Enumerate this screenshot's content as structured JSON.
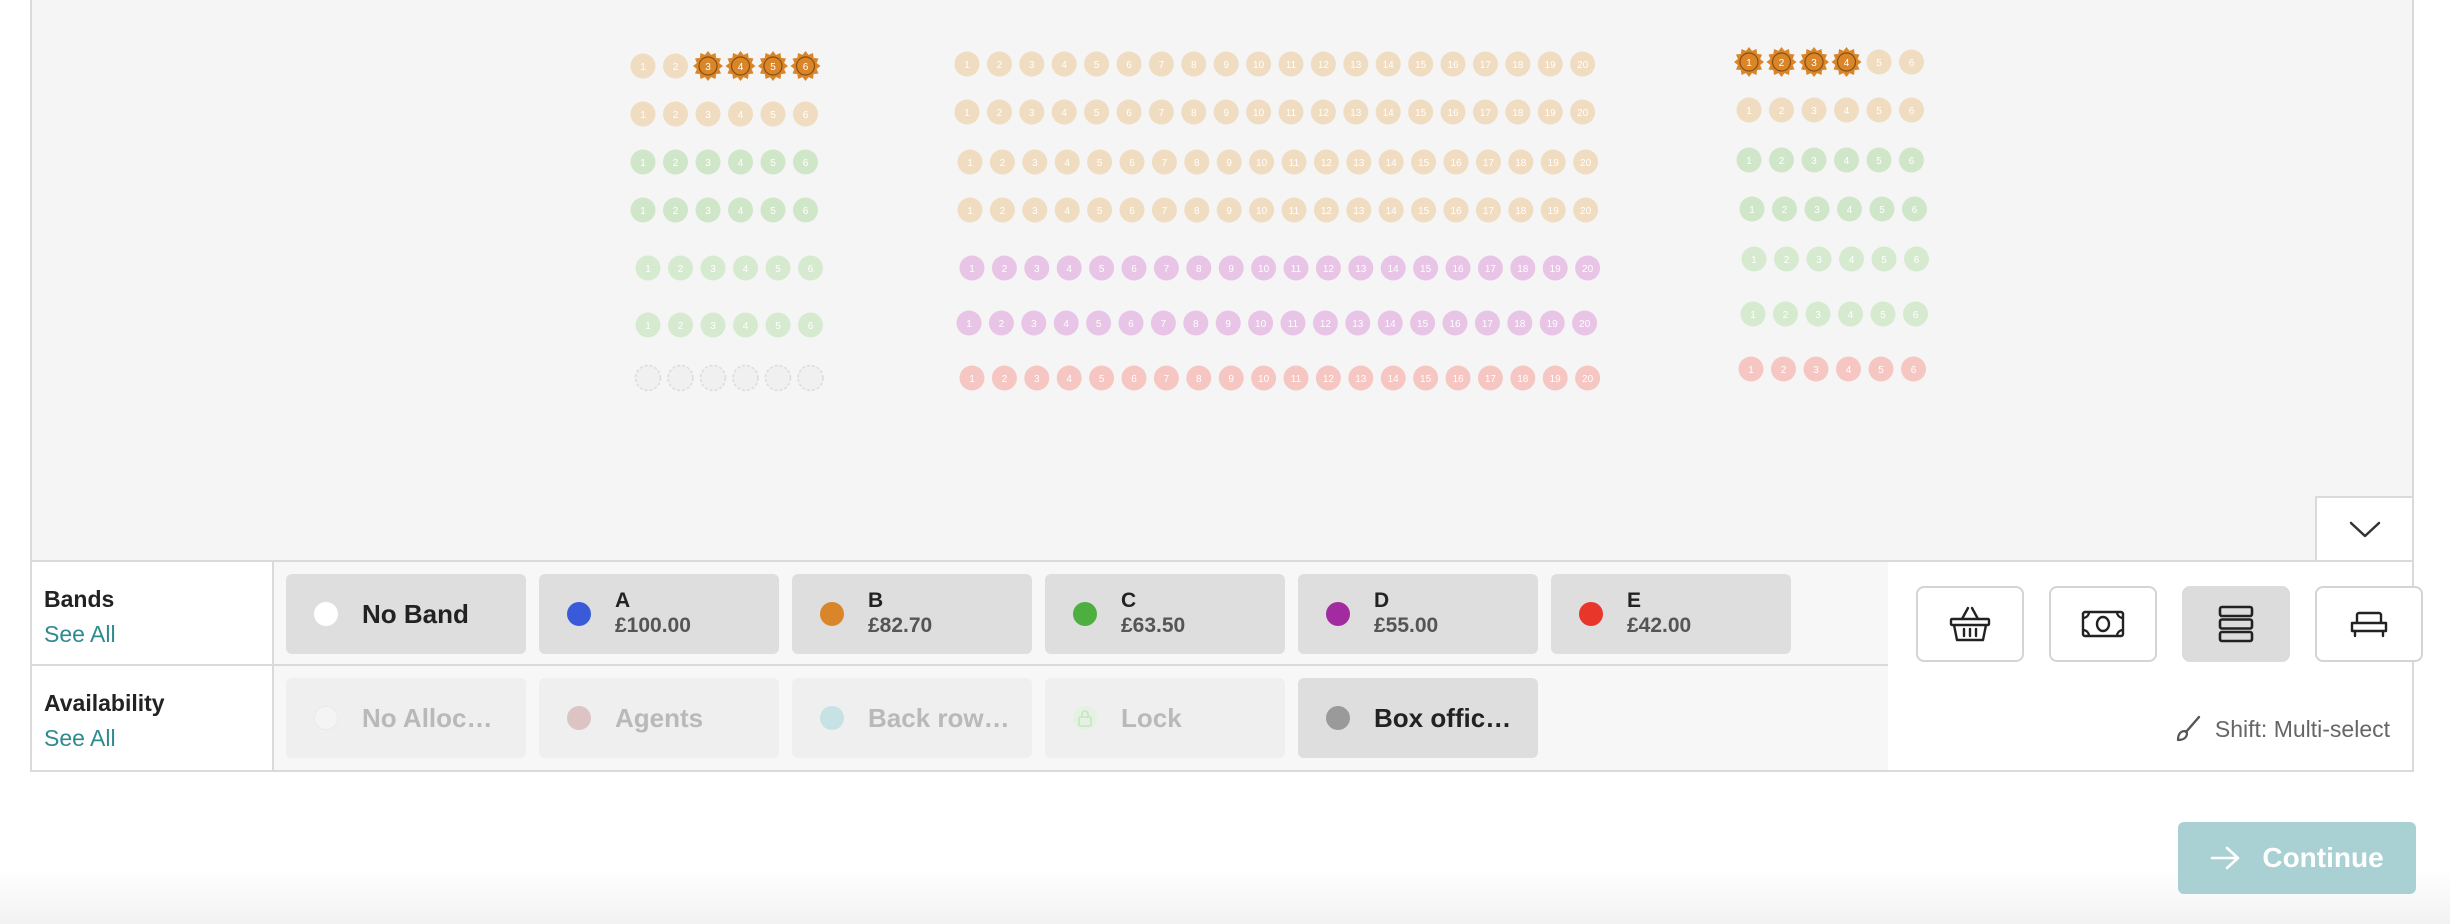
{
  "colors": {
    "no_band": "#ffffff",
    "band_a": "#3a5bd9",
    "band_b": "#d9862b",
    "band_c": "#4caf3f",
    "band_d": "#a22ba0",
    "band_e": "#e8362b",
    "accent_link": "#2f8a8f",
    "continue_bg": "#a9d1d3"
  },
  "seat_map": {
    "left_block": {
      "rows": [
        {
          "seats": [
            "1",
            "2",
            "3",
            "4",
            "5",
            "6"
          ],
          "color": "#f0dcc0",
          "selected": [
            "3",
            "4",
            "5",
            "6"
          ]
        },
        {
          "seats": [
            "1",
            "2",
            "3",
            "4",
            "5",
            "6"
          ],
          "color": "#f0dcc0"
        },
        {
          "seats": [
            "1",
            "2",
            "3",
            "4",
            "5",
            "6"
          ],
          "color": "#cfe6c8"
        },
        {
          "seats": [
            "1",
            "2",
            "3",
            "4",
            "5",
            "6"
          ],
          "color": "#cfe6c8"
        },
        {
          "seats": [
            "1",
            "2",
            "3",
            "4",
            "5",
            "6"
          ],
          "color": "#d6ead0"
        },
        {
          "seats": [
            "1",
            "2",
            "3",
            "4",
            "5",
            "6"
          ],
          "color": "#d6ead0"
        },
        {
          "seats": [
            "",
            "",
            "",
            "",
            "",
            ""
          ],
          "color": "#f0f0f0",
          "dashed": true
        }
      ]
    },
    "center_block": {
      "rows": [
        {
          "seats": [
            "1",
            "2",
            "3",
            "4",
            "5",
            "6",
            "7",
            "8",
            "9",
            "10",
            "11",
            "12",
            "13",
            "14",
            "15",
            "16",
            "17",
            "18",
            "19",
            "20"
          ],
          "color": "#f0dcc0"
        },
        {
          "seats": [
            "1",
            "2",
            "3",
            "4",
            "5",
            "6",
            "7",
            "8",
            "9",
            "10",
            "11",
            "12",
            "13",
            "14",
            "15",
            "16",
            "17",
            "18",
            "19",
            "20"
          ],
          "color": "#f0dcc0"
        },
        {
          "seats": [
            "1",
            "2",
            "3",
            "4",
            "5",
            "6",
            "7",
            "8",
            "9",
            "10",
            "11",
            "12",
            "13",
            "14",
            "15",
            "16",
            "17",
            "18",
            "19",
            "20"
          ],
          "color": "#f0dcc0"
        },
        {
          "seats": [
            "1",
            "2",
            "3",
            "4",
            "5",
            "6",
            "7",
            "8",
            "9",
            "10",
            "11",
            "12",
            "13",
            "14",
            "15",
            "16",
            "17",
            "18",
            "19",
            "20"
          ],
          "color": "#f0dcc0"
        },
        {
          "seats": [
            "1",
            "2",
            "3",
            "4",
            "5",
            "6",
            "7",
            "8",
            "9",
            "10",
            "11",
            "12",
            "13",
            "14",
            "15",
            "16",
            "17",
            "18",
            "19",
            "20"
          ],
          "color": "#e8c4e6"
        },
        {
          "seats": [
            "1",
            "2",
            "3",
            "4",
            "5",
            "6",
            "7",
            "8",
            "9",
            "10",
            "11",
            "12",
            "13",
            "14",
            "15",
            "16",
            "17",
            "18",
            "19",
            "20"
          ],
          "color": "#e8c4e6"
        },
        {
          "seats": [
            "1",
            "2",
            "3",
            "4",
            "5",
            "6",
            "7",
            "8",
            "9",
            "10",
            "11",
            "12",
            "13",
            "14",
            "15",
            "16",
            "17",
            "18",
            "19",
            "20"
          ],
          "color": "#f6c6c2"
        }
      ]
    },
    "right_block": {
      "rows": [
        {
          "seats": [
            "1",
            "2",
            "3",
            "4",
            "5",
            "6"
          ],
          "color": "#f0dcc0",
          "selected": [
            "1",
            "2",
            "3",
            "4"
          ]
        },
        {
          "seats": [
            "1",
            "2",
            "3",
            "4",
            "5",
            "6"
          ],
          "color": "#f0dcc0"
        },
        {
          "seats": [
            "1",
            "2",
            "3",
            "4",
            "5",
            "6"
          ],
          "color": "#cfe6c8"
        },
        {
          "seats": [
            "1",
            "2",
            "3",
            "4",
            "5",
            "6"
          ],
          "color": "#cfe6c8"
        },
        {
          "seats": [
            "1",
            "2",
            "3",
            "4",
            "5",
            "6"
          ],
          "color": "#d6ead0"
        },
        {
          "seats": [
            "1",
            "2",
            "3",
            "4",
            "5",
            "6"
          ],
          "color": "#d6ead0"
        },
        {
          "seats": [
            "1",
            "2",
            "3",
            "4",
            "5",
            "6"
          ],
          "color": "#f6c6c2"
        }
      ]
    }
  },
  "legend": {
    "bands": {
      "title": "Bands",
      "see_all": "See All",
      "items": [
        {
          "name": "No Band"
        },
        {
          "name": "A",
          "price": "£100.00"
        },
        {
          "name": "B",
          "price": "£82.70"
        },
        {
          "name": "C",
          "price": "£63.50"
        },
        {
          "name": "D",
          "price": "£55.00"
        },
        {
          "name": "E",
          "price": "£42.00"
        }
      ]
    },
    "availability": {
      "title": "Availability",
      "see_all": "See All",
      "items": [
        {
          "name": "No Alloc…",
          "dot": "#f4f4f4"
        },
        {
          "name": "Agents",
          "dot": "#dcc4c4"
        },
        {
          "name": "Back row…",
          "dot": "#c6e2e4"
        },
        {
          "name": "Lock",
          "icon": "lock-icon"
        },
        {
          "name": "Box offic…",
          "dot": "#9a9a9a"
        }
      ]
    }
  },
  "tools": {
    "buttons": [
      "basket-icon",
      "cash-icon",
      "list-icon",
      "seat-icon"
    ],
    "active": "list-icon",
    "multi_select_hint": "Shift: Multi-select"
  },
  "footer": {
    "continue_label": "Continue"
  }
}
